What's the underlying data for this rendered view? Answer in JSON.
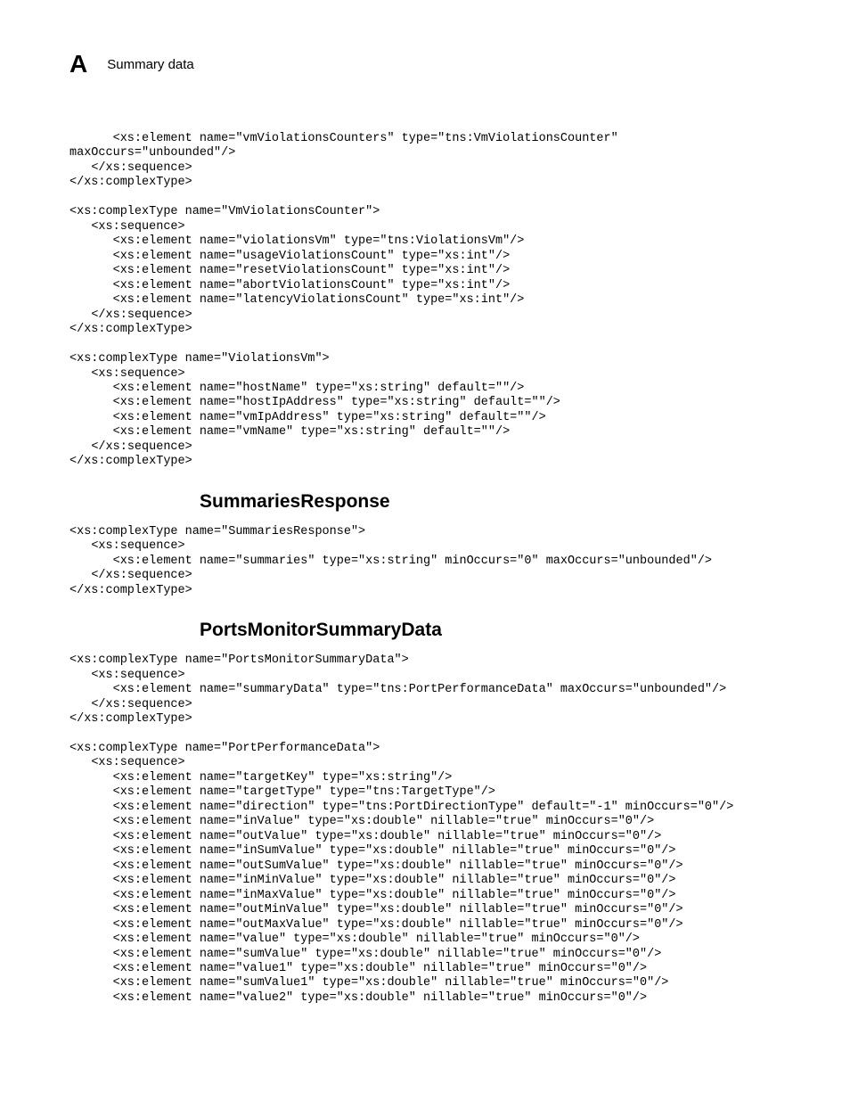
{
  "header": {
    "appendix_letter": "A",
    "title": "Summary data"
  },
  "code_block_1": "      <xs:element name=\"vmViolationsCounters\" type=\"tns:VmViolationsCounter\" maxOccurs=\"unbounded\"/>\n   </xs:sequence>\n</xs:complexType>\n\n<xs:complexType name=\"VmViolationsCounter\">\n   <xs:sequence>\n      <xs:element name=\"violationsVm\" type=\"tns:ViolationsVm\"/>\n      <xs:element name=\"usageViolationsCount\" type=\"xs:int\"/>\n      <xs:element name=\"resetViolationsCount\" type=\"xs:int\"/>\n      <xs:element name=\"abortViolationsCount\" type=\"xs:int\"/>\n      <xs:element name=\"latencyViolationsCount\" type=\"xs:int\"/>\n   </xs:sequence>\n</xs:complexType>\n\n<xs:complexType name=\"ViolationsVm\">\n   <xs:sequence>\n      <xs:element name=\"hostName\" type=\"xs:string\" default=\"\"/>\n      <xs:element name=\"hostIpAddress\" type=\"xs:string\" default=\"\"/>\n      <xs:element name=\"vmIpAddress\" type=\"xs:string\" default=\"\"/>\n      <xs:element name=\"vmName\" type=\"xs:string\" default=\"\"/>\n   </xs:sequence>\n</xs:complexType>",
  "heading_1": "SummariesResponse",
  "code_block_2": "<xs:complexType name=\"SummariesResponse\">\n   <xs:sequence>\n      <xs:element name=\"summaries\" type=\"xs:string\" minOccurs=\"0\" maxOccurs=\"unbounded\"/>\n   </xs:sequence>\n</xs:complexType>",
  "heading_2": "PortsMonitorSummaryData",
  "code_block_3": "<xs:complexType name=\"PortsMonitorSummaryData\">\n   <xs:sequence>\n      <xs:element name=\"summaryData\" type=\"tns:PortPerformanceData\" maxOccurs=\"unbounded\"/>\n   </xs:sequence>\n</xs:complexType>\n\n<xs:complexType name=\"PortPerformanceData\">\n   <xs:sequence>\n      <xs:element name=\"targetKey\" type=\"xs:string\"/>\n      <xs:element name=\"targetType\" type=\"tns:TargetType\"/>\n      <xs:element name=\"direction\" type=\"tns:PortDirectionType\" default=\"-1\" minOccurs=\"0\"/>\n      <xs:element name=\"inValue\" type=\"xs:double\" nillable=\"true\" minOccurs=\"0\"/>\n      <xs:element name=\"outValue\" type=\"xs:double\" nillable=\"true\" minOccurs=\"0\"/>\n      <xs:element name=\"inSumValue\" type=\"xs:double\" nillable=\"true\" minOccurs=\"0\"/>\n      <xs:element name=\"outSumValue\" type=\"xs:double\" nillable=\"true\" minOccurs=\"0\"/>\n      <xs:element name=\"inMinValue\" type=\"xs:double\" nillable=\"true\" minOccurs=\"0\"/>\n      <xs:element name=\"inMaxValue\" type=\"xs:double\" nillable=\"true\" minOccurs=\"0\"/>\n      <xs:element name=\"outMinValue\" type=\"xs:double\" nillable=\"true\" minOccurs=\"0\"/>\n      <xs:element name=\"outMaxValue\" type=\"xs:double\" nillable=\"true\" minOccurs=\"0\"/>\n      <xs:element name=\"value\" type=\"xs:double\" nillable=\"true\" minOccurs=\"0\"/>\n      <xs:element name=\"sumValue\" type=\"xs:double\" nillable=\"true\" minOccurs=\"0\"/>\n      <xs:element name=\"value1\" type=\"xs:double\" nillable=\"true\" minOccurs=\"0\"/>\n      <xs:element name=\"sumValue1\" type=\"xs:double\" nillable=\"true\" minOccurs=\"0\"/>\n      <xs:element name=\"value2\" type=\"xs:double\" nillable=\"true\" minOccurs=\"0\"/>"
}
